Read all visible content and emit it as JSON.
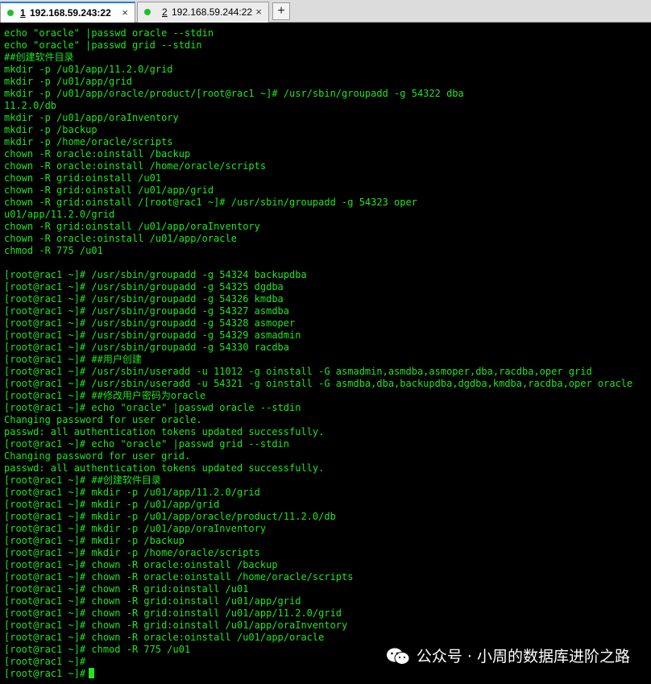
{
  "tabs": [
    {
      "number": "1",
      "host": "192.168.59.243:22",
      "close": "×",
      "status_color": "#1fbf2a"
    },
    {
      "number": "2",
      "host": "192.168.59.244:22",
      "close": "×",
      "status_color": "#1fbf2a"
    }
  ],
  "new_tab_label": "+",
  "terminal": {
    "lines": [
      "echo \"oracle\" |passwd oracle --stdin",
      "echo \"oracle\" |passwd grid --stdin",
      "##创建软件目录",
      "mkdir -p /u01/app/11.2.0/grid",
      "mkdir -p /u01/app/grid",
      "mkdir -p /u01/app/oracle/product/[root@rac1 ~]# /usr/sbin/groupadd -g 54322 dba",
      "11.2.0/db",
      "mkdir -p /u01/app/oraInventory",
      "mkdir -p /backup",
      "mkdir -p /home/oracle/scripts",
      "chown -R oracle:oinstall /backup",
      "chown -R oracle:oinstall /home/oracle/scripts",
      "chown -R grid:oinstall /u01",
      "chown -R grid:oinstall /u01/app/grid",
      "chown -R grid:oinstall /[root@rac1 ~]# /usr/sbin/groupadd -g 54323 oper",
      "u01/app/11.2.0/grid",
      "chown -R grid:oinstall /u01/app/oraInventory",
      "chown -R oracle:oinstall /u01/app/oracle",
      "chmod -R 775 /u01",
      "",
      "[root@rac1 ~]# /usr/sbin/groupadd -g 54324 backupdba",
      "[root@rac1 ~]# /usr/sbin/groupadd -g 54325 dgdba",
      "[root@rac1 ~]# /usr/sbin/groupadd -g 54326 kmdba",
      "[root@rac1 ~]# /usr/sbin/groupadd -g 54327 asmdba",
      "[root@rac1 ~]# /usr/sbin/groupadd -g 54328 asmoper",
      "[root@rac1 ~]# /usr/sbin/groupadd -g 54329 asmadmin",
      "[root@rac1 ~]# /usr/sbin/groupadd -g 54330 racdba",
      "[root@rac1 ~]# ##用户创建",
      "[root@rac1 ~]# /usr/sbin/useradd -u 11012 -g oinstall -G asmadmin,asmdba,asmoper,dba,racdba,oper grid",
      "[root@rac1 ~]# /usr/sbin/useradd -u 54321 -g oinstall -G asmdba,dba,backupdba,dgdba,kmdba,racdba,oper oracle",
      "[root@rac1 ~]# ##修改用户密码为oracle",
      "[root@rac1 ~]# echo \"oracle\" |passwd oracle --stdin",
      "Changing password for user oracle.",
      "passwd: all authentication tokens updated successfully.",
      "[root@rac1 ~]# echo \"oracle\" |passwd grid --stdin",
      "Changing password for user grid.",
      "passwd: all authentication tokens updated successfully.",
      "[root@rac1 ~]# ##创建软件目录",
      "[root@rac1 ~]# mkdir -p /u01/app/11.2.0/grid",
      "[root@rac1 ~]# mkdir -p /u01/app/grid",
      "[root@rac1 ~]# mkdir -p /u01/app/oracle/product/11.2.0/db",
      "[root@rac1 ~]# mkdir -p /u01/app/oraInventory",
      "[root@rac1 ~]# mkdir -p /backup",
      "[root@rac1 ~]# mkdir -p /home/oracle/scripts",
      "[root@rac1 ~]# chown -R oracle:oinstall /backup",
      "[root@rac1 ~]# chown -R oracle:oinstall /home/oracle/scripts",
      "[root@rac1 ~]# chown -R grid:oinstall /u01",
      "[root@rac1 ~]# chown -R grid:oinstall /u01/app/grid",
      "[root@rac1 ~]# chown -R grid:oinstall /u01/app/11.2.0/grid",
      "[root@rac1 ~]# chown -R grid:oinstall /u01/app/oraInventory",
      "[root@rac1 ~]# chown -R oracle:oinstall /u01/app/oracle",
      "[root@rac1 ~]# chmod -R 775 /u01",
      "[root@rac1 ~]#",
      "[root@rac1 ~]#"
    ],
    "text_color": "#1ee61e",
    "background": "#000000"
  },
  "watermark": {
    "text": "公众号 · 小周的数据库进阶之路",
    "icon": "wechat-icon"
  }
}
